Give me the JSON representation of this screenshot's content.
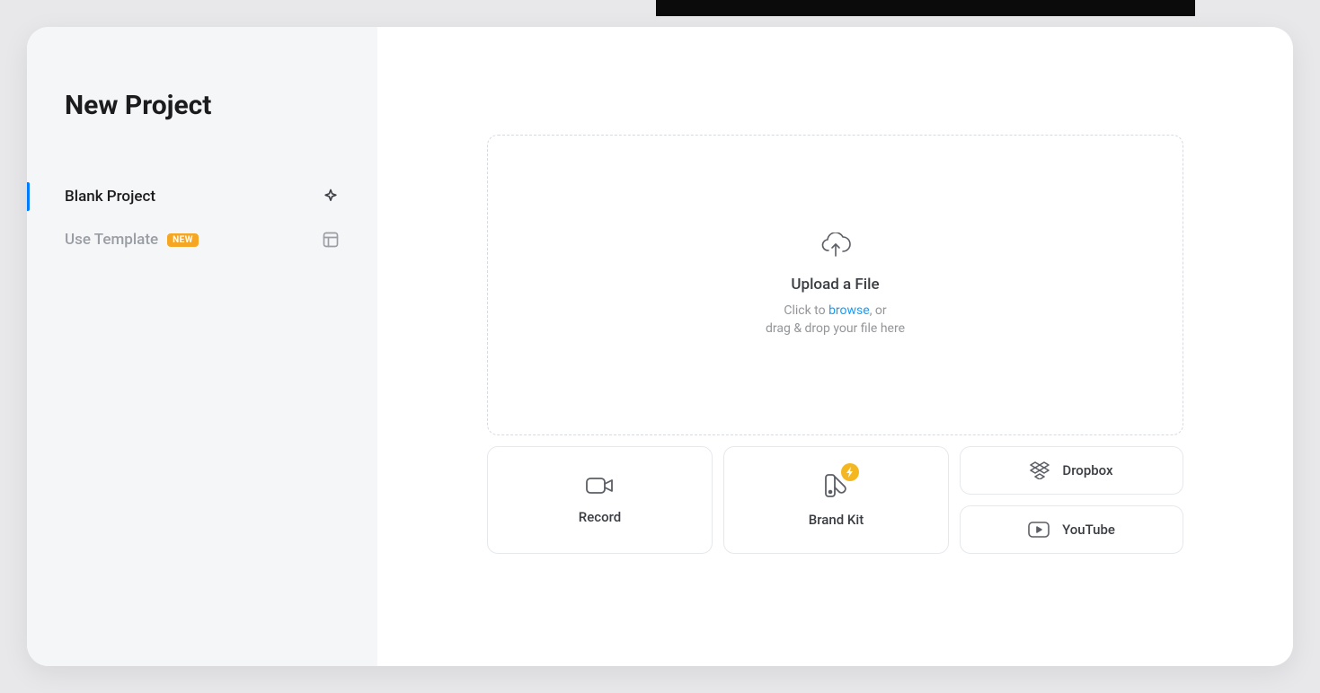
{
  "sidebar": {
    "title": "New Project",
    "items": [
      {
        "label": "Blank Project"
      },
      {
        "label": "Use Template",
        "badge": "NEW"
      }
    ]
  },
  "dropzone": {
    "title": "Upload a File",
    "sub_prefix": "Click to ",
    "browse": "browse",
    "sub_suffix": ", or",
    "sub_line2": "drag & drop your file here"
  },
  "sources": {
    "record": "Record",
    "brandkit": "Brand Kit",
    "dropbox": "Dropbox",
    "youtube": "YouTube"
  }
}
